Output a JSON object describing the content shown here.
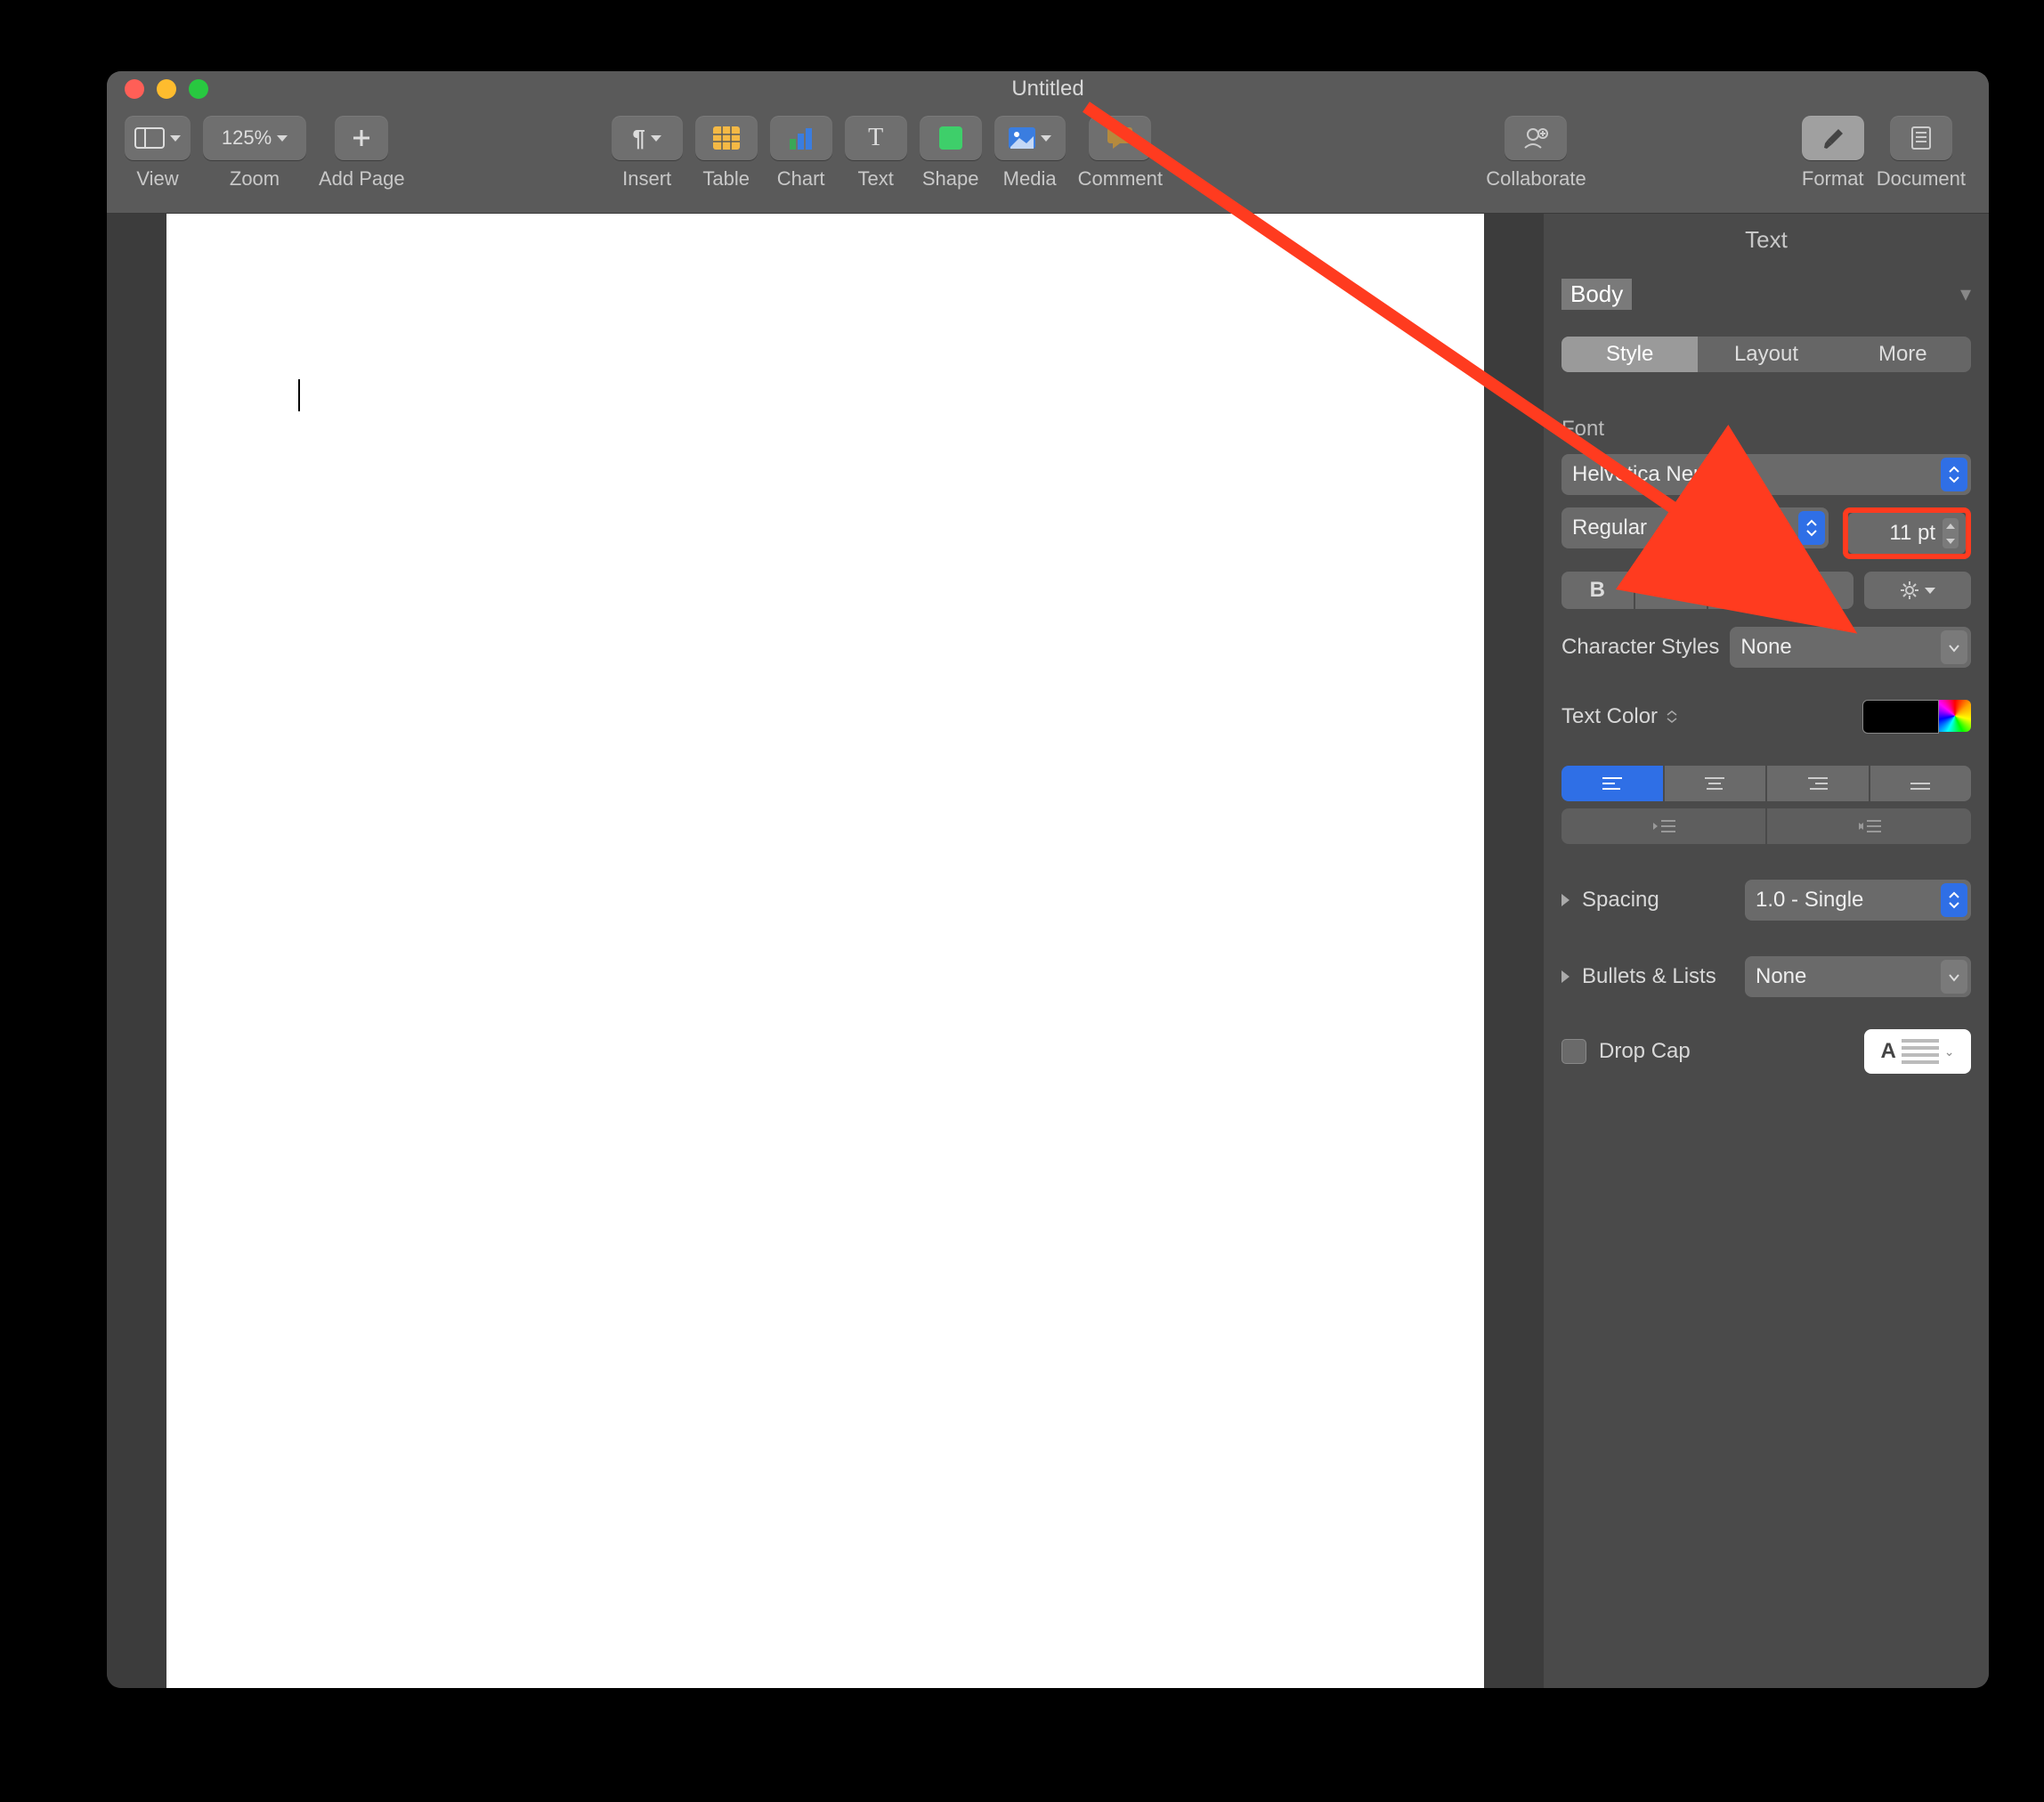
{
  "window": {
    "title": "Untitled"
  },
  "toolbar": {
    "view": "View",
    "zoom_value": "125%",
    "zoom": "Zoom",
    "add_page": "Add Page",
    "insert": "Insert",
    "table": "Table",
    "chart": "Chart",
    "text": "Text",
    "shape": "Shape",
    "media": "Media",
    "comment": "Comment",
    "collaborate": "Collaborate",
    "format": "Format",
    "document": "Document"
  },
  "inspector": {
    "title": "Text",
    "paragraph_style": "Body",
    "tabs": {
      "style": "Style",
      "layout": "Layout",
      "more": "More"
    },
    "font_label": "Font",
    "font_family": "Helvetica Neue",
    "font_weight": "Regular",
    "font_size": "11 pt",
    "char_styles_label": "Character Styles",
    "char_styles_value": "None",
    "text_color_label": "Text Color",
    "spacing_label": "Spacing",
    "spacing_value": "1.0 - Single",
    "bullets_label": "Bullets & Lists",
    "bullets_value": "None",
    "dropcap_label": "Drop Cap"
  }
}
